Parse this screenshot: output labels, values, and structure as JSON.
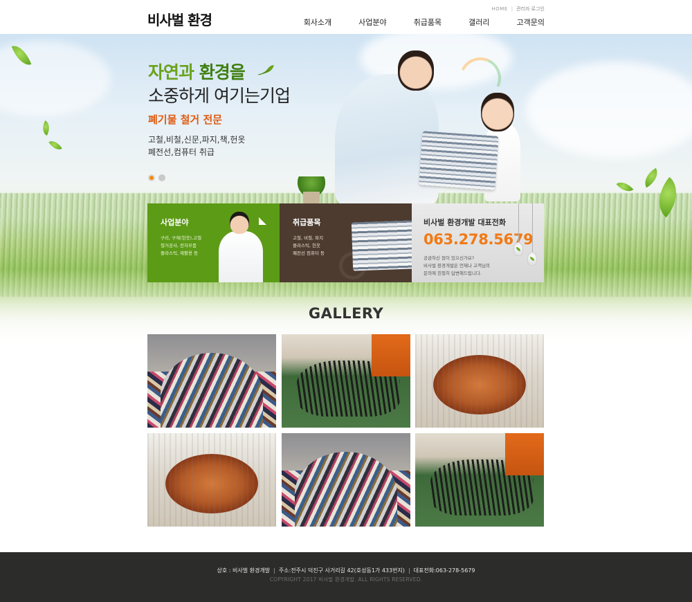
{
  "header": {
    "logo": "비사벌 환경",
    "util": {
      "home": "HOME",
      "admin_login": "관리자 로그인"
    },
    "nav": [
      "회사소개",
      "사업분야",
      "취급품목",
      "갤러리",
      "고객문의"
    ]
  },
  "hero": {
    "slogan_line1_a": "자연과 ",
    "slogan_line1_b": "환경을",
    "slogan_line2": "소중하게 여기는기업",
    "tagline": "폐기물 철거 전문",
    "items_line1": "고철,비철,신문,파지,책,헌옷",
    "items_line2": "폐전선,컴퓨터 취급",
    "slide_count": 2,
    "active_slide": 1
  },
  "features": [
    {
      "title": "사업분야",
      "desc": [
        "구리, 구재(헌옷),고철",
        "철거공사, 전자부품",
        "플라스틱, 재활용 등"
      ]
    },
    {
      "title": "취급품목",
      "desc": [
        "고철, 비철, 파지",
        "플라스틱, 헌옷",
        "폐전선 컴퓨터 등"
      ]
    },
    {
      "title": "비사벌 환경개발 대표전화",
      "phone": "063.278.5679",
      "desc": [
        "궁금하신 점이 있으신가요?",
        "비사벌 환경개발은 언제나 고객님의",
        "문의에 친절히 답변해드립니다."
      ]
    }
  ],
  "gallery": {
    "title": "GALLERY",
    "photos": [
      "clothes-pile",
      "black-cables",
      "copper-wire",
      "copper-wire",
      "clothes-pile",
      "black-cables"
    ]
  },
  "footer": {
    "company": "상호 : 비사벌 환경개발",
    "address": "주소:전주시 덕진구 사거리길 42(호성동1가 433번지)",
    "phone": "대표전화:063-278-5679",
    "copyright": "COPYRIGHT 2017 비사벌 환경개발. ALL RIGHTS RESERVED."
  },
  "colors": {
    "brand_green": "#5c9b16",
    "brand_brown": "#4d3b30",
    "accent_orange": "#f07a15",
    "footer_bg": "#2c2c2a"
  }
}
